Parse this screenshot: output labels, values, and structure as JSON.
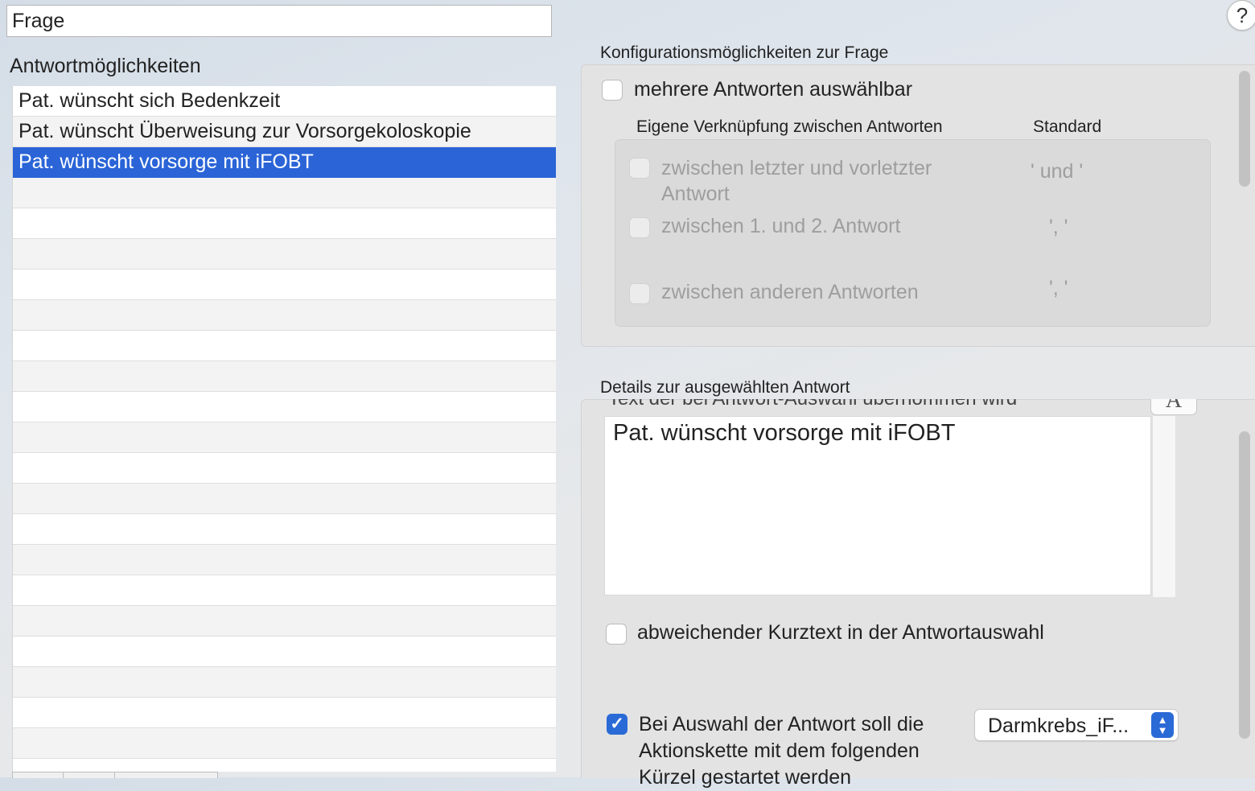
{
  "question": {
    "value": "Frage"
  },
  "answers": {
    "heading": "Antwortmöglichkeiten",
    "items": [
      {
        "label": "Pat. wünscht sich Bedenkzeit",
        "selected": false
      },
      {
        "label": "Pat. wünscht Überweisung zur Vorsorgekoloskopie",
        "selected": false
      },
      {
        "label": "Pat. wünscht vorsorge mit iFOBT",
        "selected": true
      }
    ]
  },
  "help": {
    "label": "?"
  },
  "config": {
    "title": "Konfigurationsmöglichkeiten zur Frage",
    "multiple_label": "mehrere Antworten auswählbar",
    "multiple_checked": false,
    "link_header": "Eigene Verknüpfung zwischen Antworten",
    "standard_header": "Standard",
    "options": [
      {
        "label": "zwischen letzter und vorletzter Antwort",
        "standard": "' und '",
        "checked": false,
        "enabled": false
      },
      {
        "label": "zwischen 1. und 2. Antwort",
        "standard": "', '",
        "checked": false,
        "enabled": false
      },
      {
        "label": "zwischen anderen Antworten",
        "standard": "', '",
        "checked": false,
        "enabled": false
      }
    ]
  },
  "details": {
    "title": "Details zur ausgewählten Antwort",
    "cut_label": "Text der bei Antwort-Auswahl übernommen wird",
    "font_icon": "A",
    "answer_text": "Pat. wünscht vorsorge mit iFOBT",
    "short_text_label": "abweichender Kurztext in der Antwortauswahl",
    "short_text_checked": false,
    "action_label": "Bei Auswahl der Antwort soll die Aktionskette mit dem folgenden Kürzel gestartet werden",
    "action_checked": true,
    "action_chain_value": "Darmkrebs_iF..."
  },
  "colors": {
    "selection": "#2a64d7",
    "accent": "#2a6ad6"
  }
}
